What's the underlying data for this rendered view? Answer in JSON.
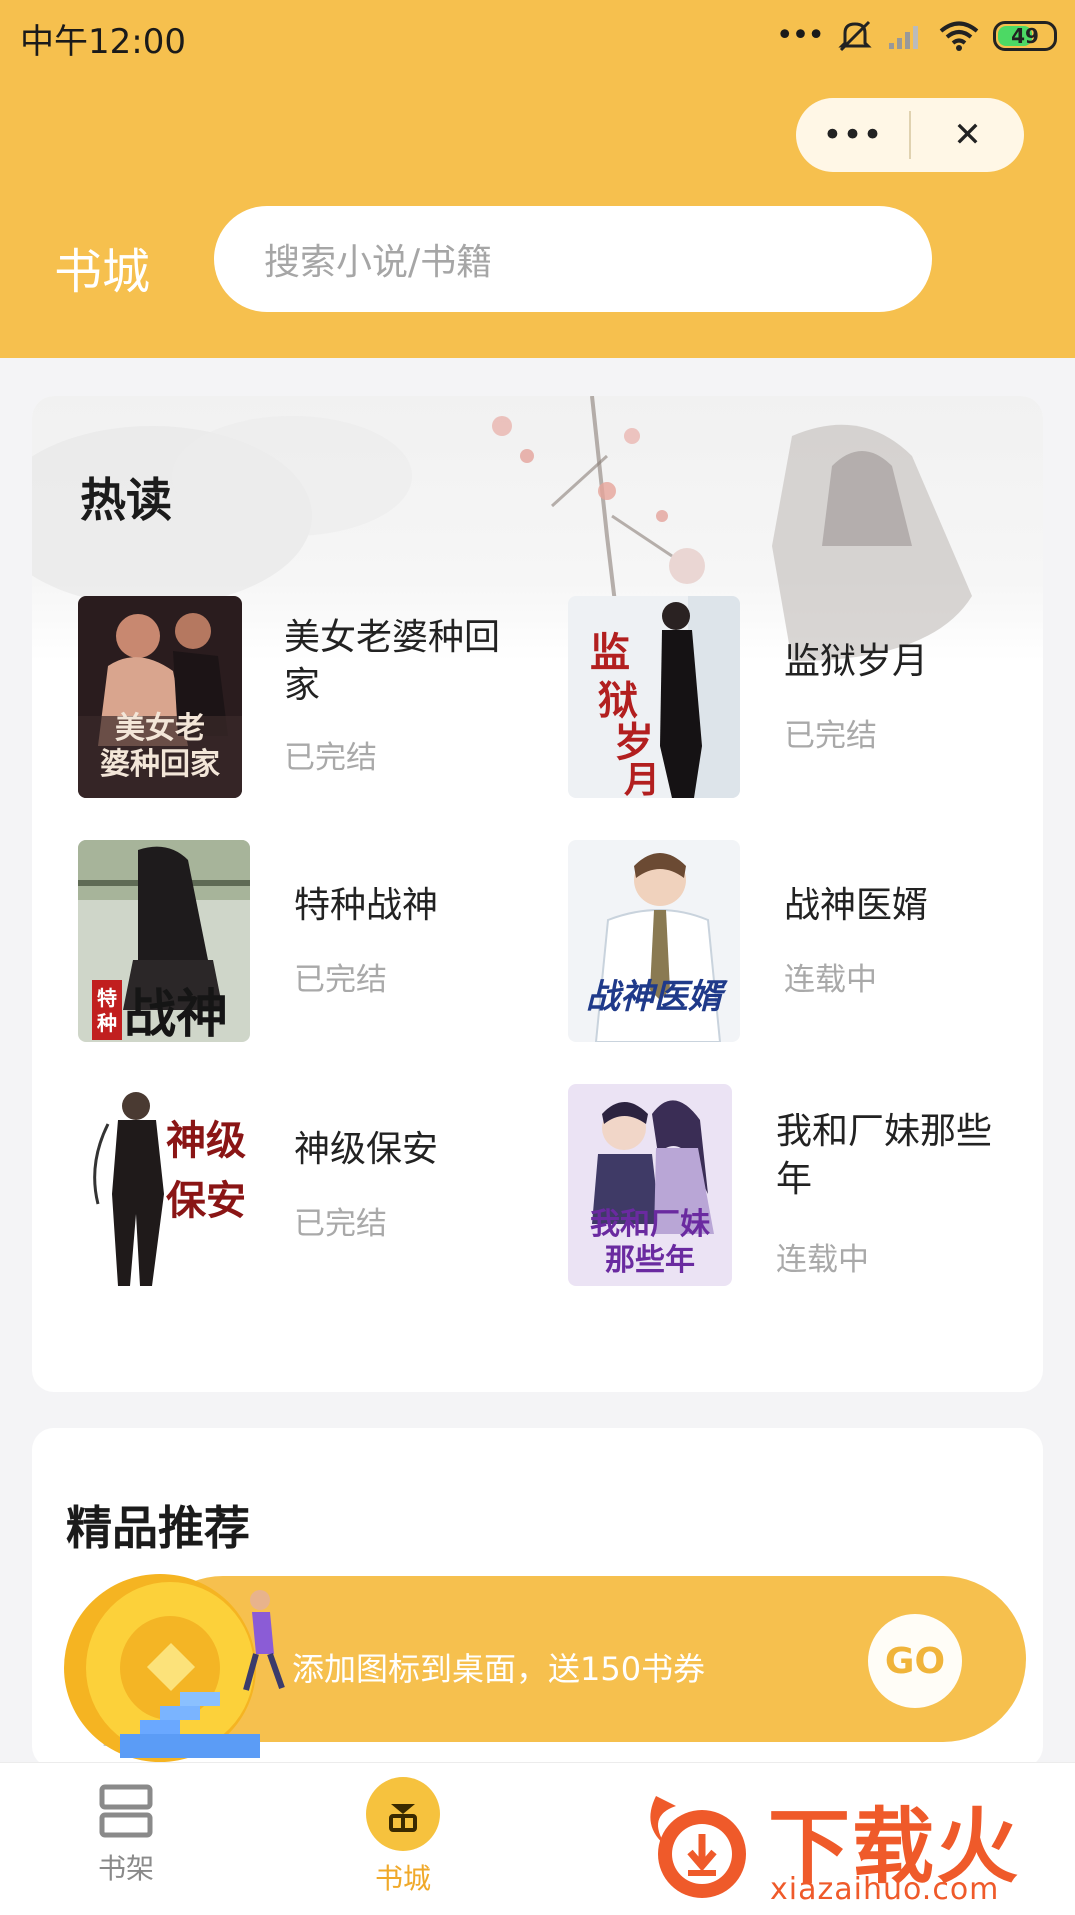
{
  "status_bar": {
    "time": "中午12:00",
    "battery": "49"
  },
  "capsule": {
    "more_label": "•••",
    "close_label": "✕"
  },
  "header": {
    "title": "书城",
    "search_placeholder": "搜索小说/书籍"
  },
  "hot": {
    "title": "热读",
    "books": [
      {
        "title": "美女老婆种回家",
        "status": "已完结",
        "cover_text": "美女老婆种回家"
      },
      {
        "title": "监狱岁月",
        "status": "已完结",
        "cover_text": "监狱岁月"
      },
      {
        "title": "特种战神",
        "status": "已完结",
        "cover_text": "战神"
      },
      {
        "title": "战神医婿",
        "status": "连载中",
        "cover_text": "战神医婿"
      },
      {
        "title": "神级保安",
        "status": "已完结",
        "cover_text": "神级保安"
      },
      {
        "title": "我和厂妹那些年",
        "status": "连载中",
        "cover_text": "我和厂妹那些年"
      }
    ]
  },
  "recommend": {
    "title": "精品推荐",
    "partial_text": "…"
  },
  "promo": {
    "text": "添加图标到桌面，送150书券",
    "button": "GO"
  },
  "tabbar": {
    "tabs": [
      {
        "label": "书架",
        "icon": "bookshelf-icon"
      },
      {
        "label": "书城",
        "icon": "store-icon"
      }
    ]
  },
  "watermark": {
    "brand": "下载火",
    "url": "xiazaihuo.com"
  },
  "colors": {
    "accent": "#f6c04e",
    "store_active": "#f0a92a",
    "watermark": "#ef5a2a"
  }
}
